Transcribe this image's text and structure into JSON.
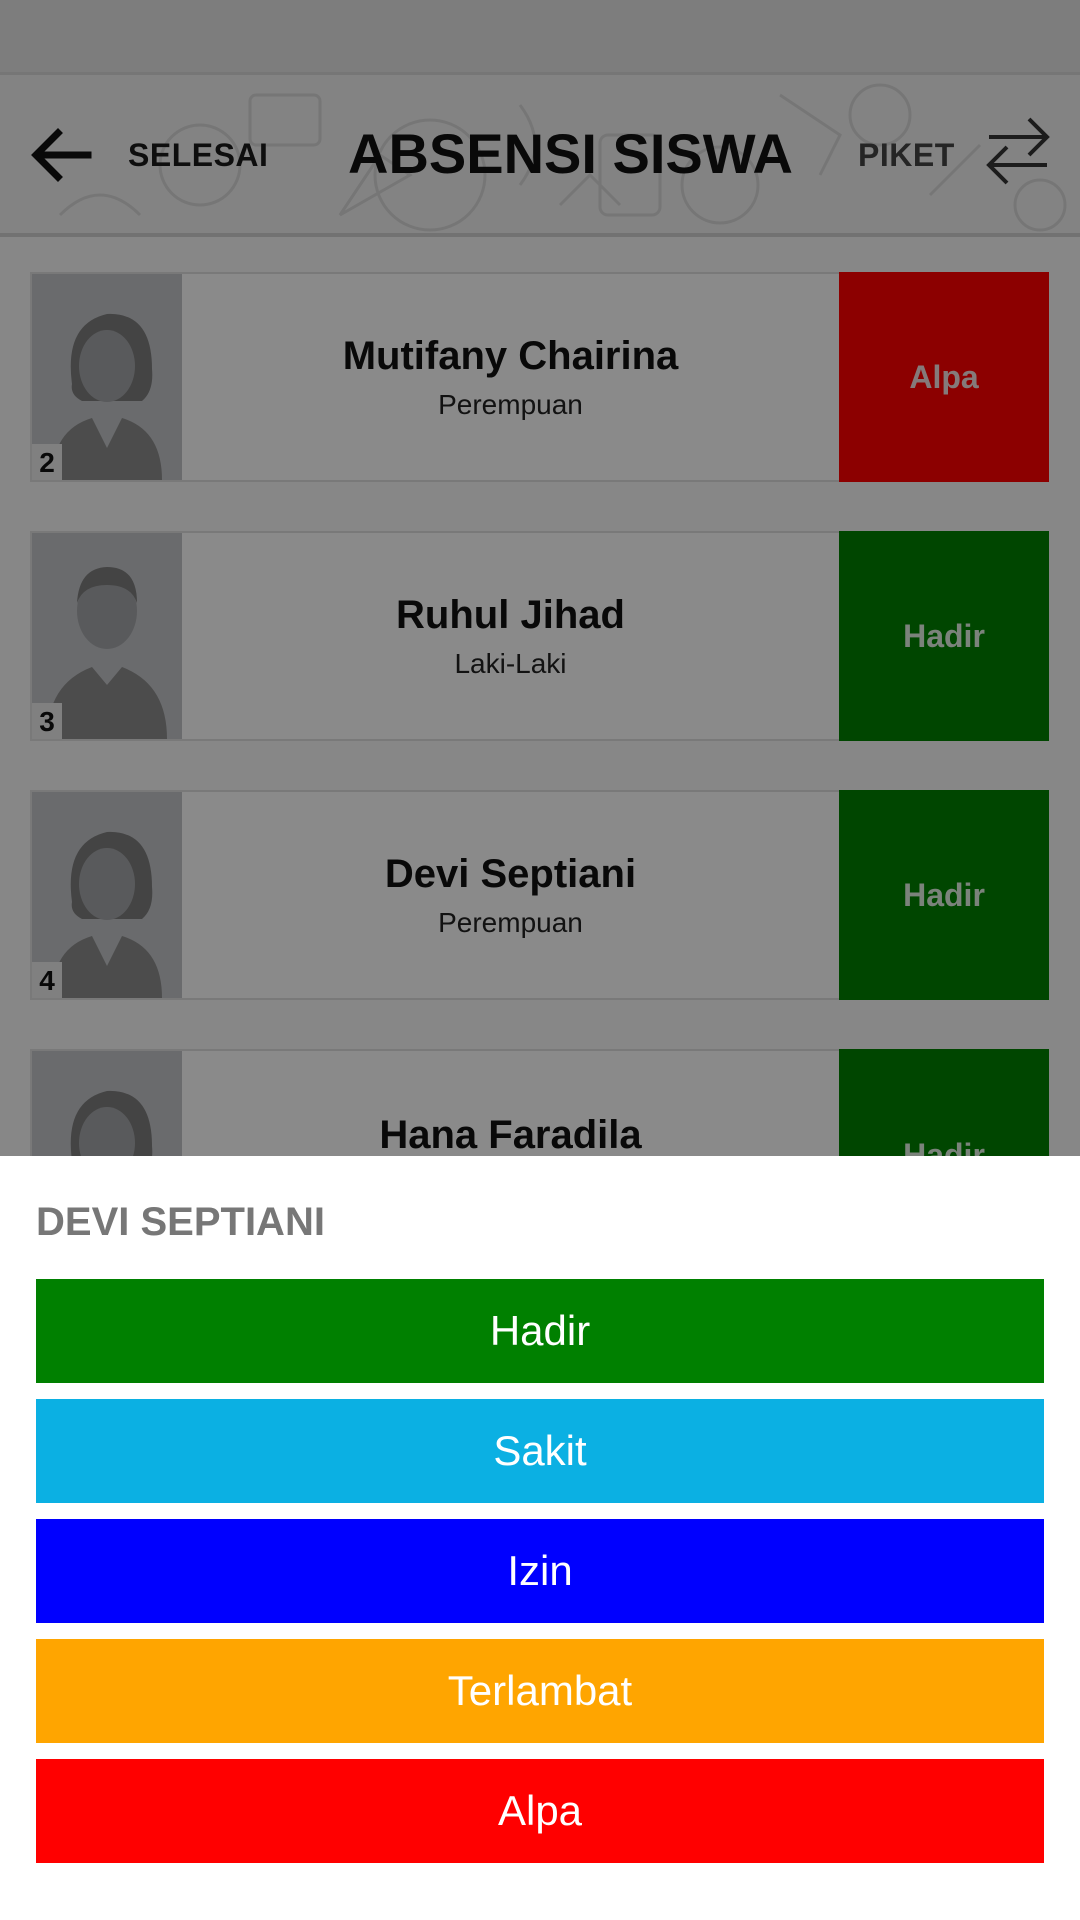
{
  "header": {
    "back_label": "SELESAI",
    "title": "ABSENSI SISWA",
    "piket_label": "PIKET"
  },
  "students": [
    {
      "number": "2",
      "name": "Mutifany Chairina",
      "gender": "Perempuan",
      "status": "Alpa",
      "status_color": "#ff0000"
    },
    {
      "number": "3",
      "name": "Ruhul Jihad",
      "gender": "Laki-Laki",
      "status": "Hadir",
      "status_color": "#008000"
    },
    {
      "number": "4",
      "name": "Devi Septiani",
      "gender": "Perempuan",
      "status": "Hadir",
      "status_color": "#008000"
    },
    {
      "number": "",
      "name": "Hana Faradila",
      "gender": "",
      "status": "Hadir",
      "status_color": "#008000"
    }
  ],
  "sheet": {
    "title": "DEVI SEPTIANI",
    "options": [
      {
        "label": "Hadir",
        "color": "#008000"
      },
      {
        "label": "Sakit",
        "color": "#0bb0e3"
      },
      {
        "label": "Izin",
        "color": "#0000ff"
      },
      {
        "label": "Terlambat",
        "color": "#ffa500"
      },
      {
        "label": "Alpa",
        "color": "#ff0000"
      }
    ]
  },
  "colors": {
    "scrim": "rgba(0,0,0,0.45)",
    "card_bg": "#fbfbfb",
    "avatar_bg": "#c1c3c6"
  },
  "icons": {
    "back": "arrow-left-icon",
    "swap": "swap-arrows-icon",
    "female_avatar": "female-avatar-icon",
    "male_avatar": "male-avatar-icon"
  }
}
